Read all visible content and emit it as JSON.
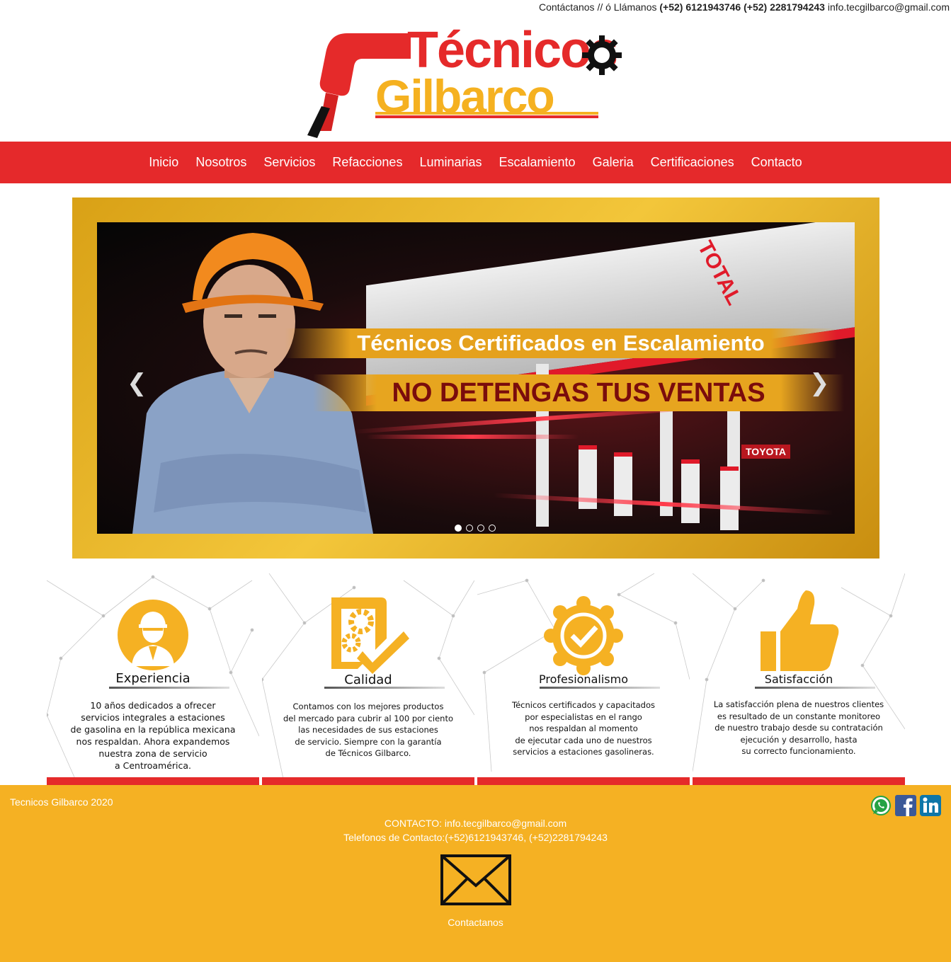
{
  "topbar": {
    "prefix": "Contáctanos // ó Llámanos",
    "phones": "(+52) 6121943746 (+52) 2281794243",
    "email": "info.tecgilbarco@gmail.com"
  },
  "logo": {
    "line1": "Técnicos",
    "line2": "Gilbarco"
  },
  "nav": [
    "Inicio",
    "Nosotros",
    "Servicios",
    "Refacciones",
    "Luminarias",
    "Escalamiento",
    "Galeria",
    "Certificaciones",
    "Contacto"
  ],
  "slider": {
    "headline": "Técnicos Certificados en Escalamiento",
    "tagline": "NO DETENGAS TUS VENTAS",
    "sign_total": "TOTAL",
    "sign_toyota": "TOYOTA",
    "prev_icon": "chevron-left-icon",
    "next_icon": "chevron-right-icon",
    "slide_count": 4,
    "active_slide": 1
  },
  "features": [
    {
      "title": "Experiencia",
      "icon": "worker-icon",
      "lines": [
        "10 años dedicados a ofrecer",
        "servicios integrales a estaciones",
        "de gasolina en la república mexicana",
        "nos respaldan. Ahora expandemos",
        "nuestra zona de servicio",
        "a Centroamérica."
      ]
    },
    {
      "title": "Calidad",
      "icon": "gear-check-icon",
      "lines": [
        "Contamos con los mejores productos",
        "del mercado para cubrir al 100 por ciento",
        "las necesidades de sus estaciones",
        "de servicio. Siempre con la garantía",
        "de Técnicos Gilbarco."
      ]
    },
    {
      "title": "Profesionalismo",
      "icon": "badge-check-icon",
      "lines": [
        "Técnicos certificados y capacitados",
        "por especialistas en el rango",
        "nos respaldan al momento",
        "de ejecutar cada uno de nuestros",
        "servicios a estaciones gasolineras."
      ]
    },
    {
      "title": "Satisfacción",
      "icon": "thumbs-up-icon",
      "lines": [
        "La satisfacción plena de nuestros clientes",
        "es resultado de un constante monitoreo",
        "de nuestro trabajo desde su contratación",
        "ejecución y desarrollo, hasta",
        "su correcto funcionamiento."
      ]
    }
  ],
  "footer": {
    "copyright": "Tecnicos Gilbarco 2020",
    "contact_line": "CONTACTO: info.tecgilbarco@gmail.com",
    "phones_line": "Telefonos de Contacto:(+52)6121943746, (+52)2281794243",
    "cta": "Contactanos",
    "social": [
      "whatsapp-icon",
      "facebook-icon",
      "linkedin-icon"
    ]
  },
  "colors": {
    "red": "#e5292b",
    "gold": "#f5b123",
    "white": "#ffffff"
  }
}
